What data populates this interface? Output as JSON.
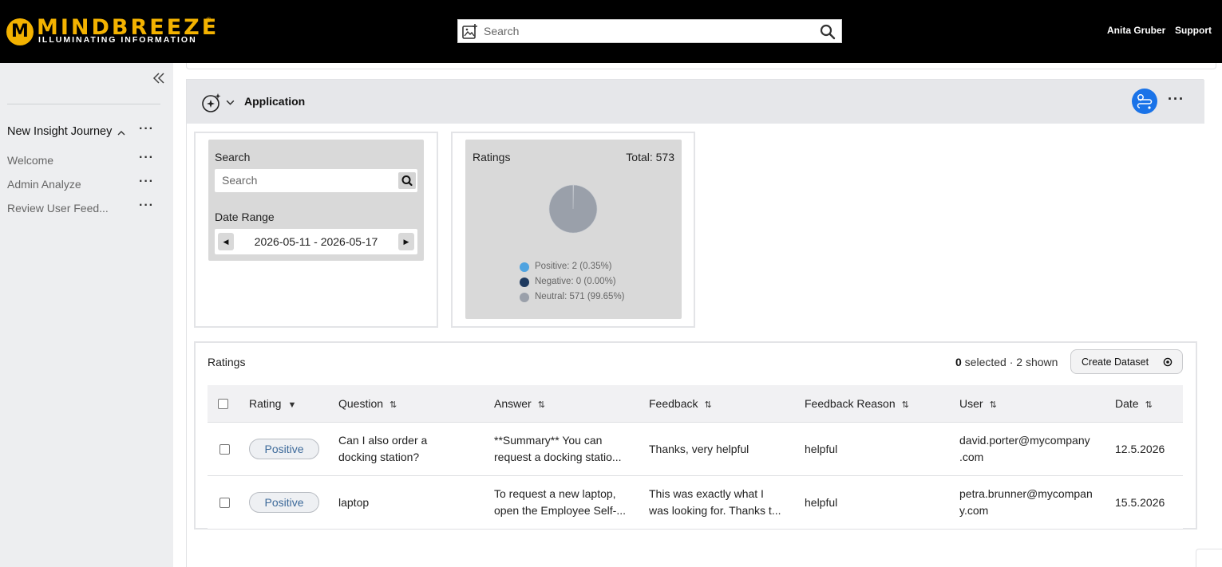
{
  "header": {
    "logo_word": "MINDBREEZE",
    "logo_mark": "M",
    "logo_registered": "®",
    "logo_tagline": "ILLUMINATING INFORMATION",
    "search_placeholder": "Search",
    "user_name": "Anita Gruber",
    "support_label": "Support"
  },
  "sidebar": {
    "collapse_icon": "double-chevron-left-icon",
    "journey_title": "New Insight Journey",
    "more_label": "···",
    "items": [
      {
        "label": "Welcome"
      },
      {
        "label": "Admin Analyze"
      },
      {
        "label": "Review User Feed..."
      }
    ]
  },
  "app": {
    "title": "Application",
    "more_label": "···"
  },
  "search_widget": {
    "search_label": "Search",
    "search_placeholder": "Search",
    "date_range_label": "Date Range",
    "date_range_value": "2026-05-11 - 2026-05-17",
    "prev_label": "◀",
    "next_label": "▶"
  },
  "ratings_widget": {
    "title": "Ratings",
    "total_label": "Total: 573"
  },
  "chart_data": {
    "type": "pie",
    "categories": [
      "Positive",
      "Negative",
      "Neutral"
    ],
    "values": [
      2,
      0,
      571
    ],
    "legend_labels": [
      "Positive: 2 (0.35%)",
      "Negative: 0 (0.00%)",
      "Neutral: 571 (99.65%)"
    ],
    "colors": [
      "#4fa3e0",
      "#1f3a5f",
      "#9aa0aa"
    ],
    "legend_position": "bottom"
  },
  "table": {
    "title": "Ratings",
    "selected_count": "0",
    "selected_suffix": " selected · 2 shown",
    "create_dataset_label": "Create Dataset",
    "columns": [
      {
        "label": "Rating",
        "sort": "▼"
      },
      {
        "label": "Question",
        "sort": "⇅"
      },
      {
        "label": "Answer",
        "sort": "⇅"
      },
      {
        "label": "Feedback",
        "sort": "⇅"
      },
      {
        "label": "Feedback Reason",
        "sort": "⇅"
      },
      {
        "label": "User",
        "sort": "⇅"
      },
      {
        "label": "Date",
        "sort": "⇅"
      }
    ],
    "rows": [
      {
        "rating": "Positive",
        "question_1": "Can I also order a",
        "question_2": "docking station?",
        "answer_1": "**Summary** You can",
        "answer_2": "request a docking statio...",
        "feedback_1": "Thanks, very helpful",
        "reason": "helpful",
        "user_1": "david.porter@mycompany",
        "user_2": ".com",
        "date": "12.5.2026"
      },
      {
        "rating": "Positive",
        "question_1": "laptop",
        "answer_1": "To request a new laptop,",
        "answer_2": "open the Employee Self-...",
        "feedback_1": "This was exactly what I",
        "feedback_2": "was looking for. Thanks t...",
        "reason": "helpful",
        "user_1": "petra.brunner@mycompan",
        "user_2": "y.com",
        "date": "15.5.2026"
      }
    ]
  }
}
